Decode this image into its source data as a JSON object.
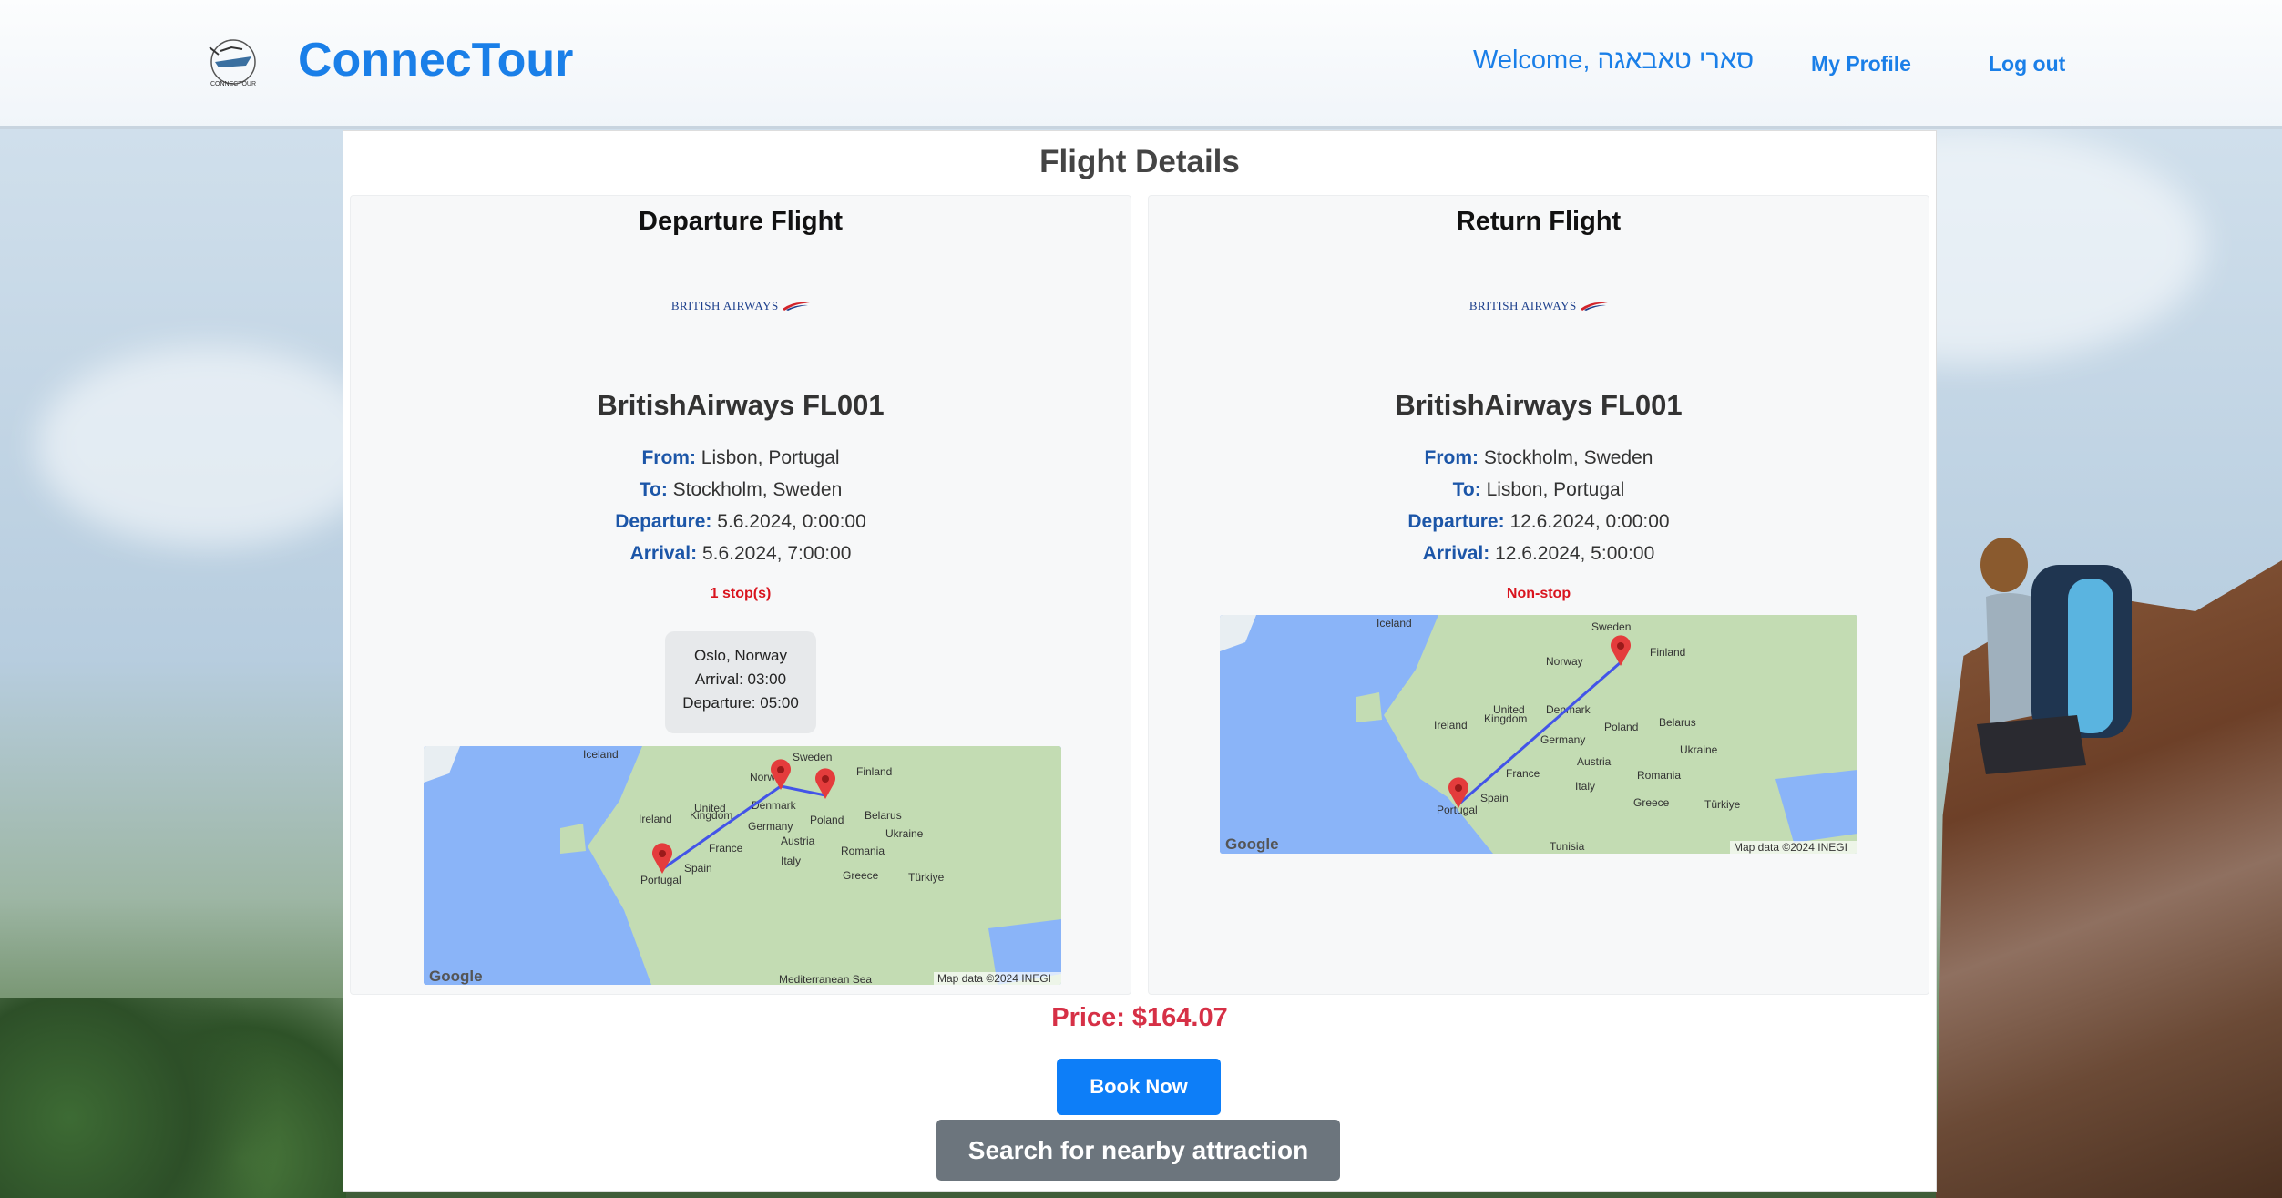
{
  "header": {
    "brand": "ConnecTour",
    "logo_text": "CONNECTOUR",
    "welcome": "Welcome, סארי טאבאגה",
    "nav": {
      "profile": "My Profile",
      "logout": "Log out"
    }
  },
  "main": {
    "title": "Flight Details",
    "labels": {
      "from": "From:",
      "to": "To:",
      "departure": "Departure:",
      "arrival": "Arrival:"
    },
    "departure_flight": {
      "heading": "Departure Flight",
      "airline_logo_text": "BRITISH AIRWAYS",
      "flight_name": "BritishAirways FL001",
      "from": "Lisbon, Portugal",
      "to": "Stockholm, Sweden",
      "departure": "5.6.2024, 0:00:00",
      "arrival": "5.6.2024, 7:00:00",
      "stops": "1 stop(s)",
      "stop": {
        "city": "Oslo, Norway",
        "arrival": "Arrival: 03:00",
        "departure": "Departure: 05:00"
      },
      "map": {
        "labels": [
          "Iceland",
          "Sweden",
          "Finland",
          "Norway",
          "Denmark",
          "United",
          "Kingdom",
          "Ireland",
          "Poland",
          "Belarus",
          "Germany",
          "Ukraine",
          "Austria",
          "France",
          "Romania",
          "Italy",
          "Spain",
          "Greece",
          "Türkiye",
          "Portugal"
        ],
        "footer": "Map data ©2024 INEGI",
        "sea": "Mediterranean Sea",
        "google": "Google"
      }
    },
    "return_flight": {
      "heading": "Return Flight",
      "airline_logo_text": "BRITISH AIRWAYS",
      "flight_name": "BritishAirways FL001",
      "from": "Stockholm, Sweden",
      "to": "Lisbon, Portugal",
      "departure": "12.6.2024, 0:00:00",
      "arrival": "12.6.2024, 5:00:00",
      "stops": "Non-stop",
      "map": {
        "labels": [
          "Iceland",
          "Sweden",
          "Finland",
          "Norway",
          "Denmark",
          "United",
          "Kingdom",
          "Ireland",
          "Poland",
          "Belarus",
          "Germany",
          "Ukraine",
          "Austria",
          "France",
          "Romania",
          "Italy",
          "Spain",
          "Greece",
          "Türkiye",
          "Portugal",
          "Tunisia"
        ],
        "footer": "Map data ©2024 INEGI",
        "google": "Google"
      }
    },
    "price": "Price: $164.07",
    "book_button": "Book Now",
    "search_button": "Search for nearby attraction"
  },
  "colors": {
    "brand_blue": "#1a7fe8",
    "label_blue": "#1c56a8",
    "price_red": "#d63046",
    "stops_red": "#d9141e",
    "book_button": "#0d7ef8",
    "search_button": "#6c757d"
  }
}
